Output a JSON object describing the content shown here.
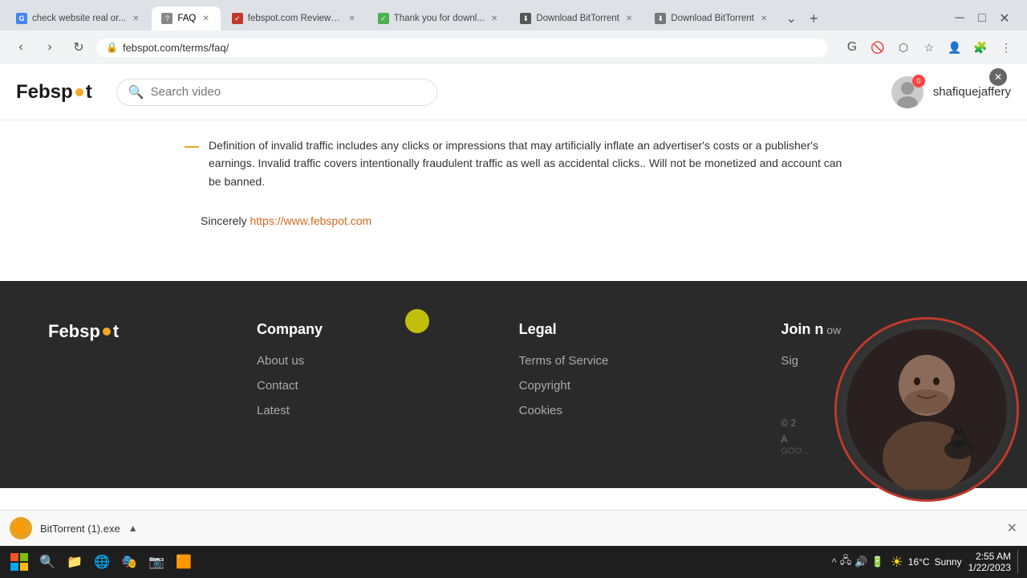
{
  "browser": {
    "tabs": [
      {
        "id": "tab1",
        "label": "check website real or...",
        "favicon": "G",
        "favicon_class": "favicon-circle-g",
        "active": false
      },
      {
        "id": "tab2",
        "label": "FAQ",
        "favicon": "?",
        "favicon_class": "favicon-circle-faq",
        "active": true
      },
      {
        "id": "tab3",
        "label": "febspot.com Reviews...",
        "favicon": "✓",
        "favicon_class": "favicon-circle-shield",
        "active": false
      },
      {
        "id": "tab4",
        "label": "Thank you for downl...",
        "favicon": "✓",
        "favicon_class": "favicon-circle-ty",
        "active": false
      },
      {
        "id": "tab5",
        "label": "Download BitTorrent",
        "favicon": "⬇",
        "favicon_class": "favicon-circle-dl",
        "active": false
      },
      {
        "id": "tab6",
        "label": "Download BitTorrent",
        "favicon": "⬇",
        "favicon_class": "favicon-circle-dl2",
        "active": false
      }
    ],
    "url": "febspot.com/terms/faq/",
    "new_tab_label": "+"
  },
  "header": {
    "logo_text_1": "Febsp",
    "logo_text_2": "t",
    "search_placeholder": "Search video",
    "user_name": "shafiquejaffery",
    "notification_count": "0"
  },
  "main_content": {
    "bullet_text": "Definition of invalid traffic includes any clicks or impressions that may artificially inflate an advertiser's costs or a publisher's earnings. Invalid traffic covers intentionally fraudulent traffic as well as accidental clicks.. Will not be monetized and account can be banned.",
    "sincerely_prefix": "Sincerely",
    "sincerely_link": "https://www.febspot.com"
  },
  "footer": {
    "logo_text_1": "Febsp",
    "logo_text_2": "t",
    "company": {
      "title": "Company",
      "links": [
        "About us",
        "Contact",
        "Latest"
      ]
    },
    "legal": {
      "title": "Legal",
      "links": [
        "Terms of Service",
        "Copyright",
        "Cookies"
      ]
    },
    "join": {
      "title": "Join n",
      "links": [
        "Sig"
      ]
    },
    "copyright_partial": "© 2",
    "android_partial": "A"
  },
  "download_bar": {
    "filename": "BitTorrent (1).exe",
    "icon": "🔥"
  },
  "taskbar": {
    "start_icon": "⊞",
    "icons": [
      "🔍",
      "📁",
      "🌐",
      "🎭",
      "📷",
      "🟧"
    ],
    "weather_temp": "16°C",
    "weather_desc": "Sunny",
    "time": "2:55 AM",
    "date": "1/22/2023"
  }
}
